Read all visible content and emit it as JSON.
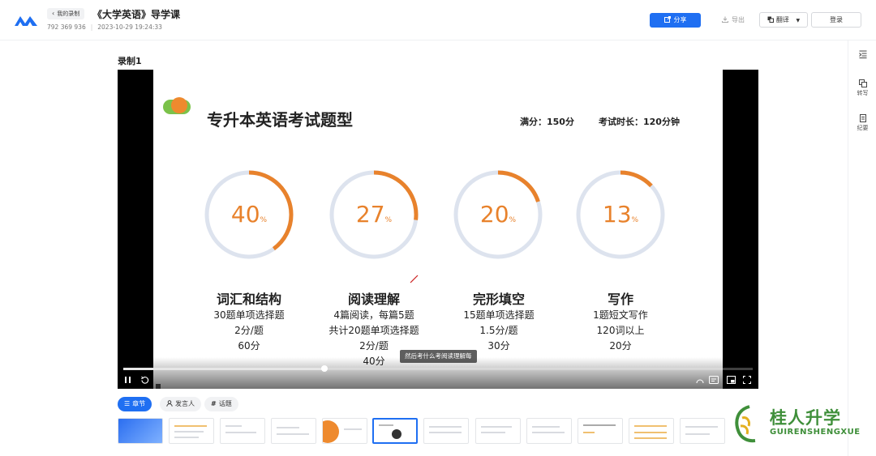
{
  "header": {
    "back_label": "我的录制",
    "title": "《大学英语》导学课",
    "meeting_id": "792 369 936",
    "datetime": "2023-10-29 19:24:33",
    "share_label": "分享",
    "export_label": "导出",
    "translate_label": "翻译",
    "login_label": "登录"
  },
  "right_rail": {
    "items": [
      {
        "label": ""
      },
      {
        "label": "转写"
      },
      {
        "label": "纪要"
      }
    ]
  },
  "section_title": "录制1",
  "slide": {
    "title": "专升本英语考试题型",
    "score": "满分：150分",
    "duration": "考试时长：120分钟",
    "items": [
      {
        "percent": "40",
        "unit": "%",
        "fraction": 0.4,
        "name": "词汇和结构",
        "lines": [
          "30题单项选择题",
          "2分/题",
          "60分"
        ]
      },
      {
        "percent": "27",
        "unit": "%",
        "fraction": 0.27,
        "name": "阅读理解",
        "lines": [
          "4篇阅读，每篇5题",
          "共计20题单项选择题",
          "2分/题",
          "40分"
        ]
      },
      {
        "percent": "20",
        "unit": "%",
        "fraction": 0.2,
        "name": "完形填空",
        "lines": [
          "15题单项选择题",
          "1.5分/题",
          "30分"
        ]
      },
      {
        "percent": "13",
        "unit": "%",
        "fraction": 0.13,
        "name": "写作",
        "lines": [
          "1题短文写作",
          "120词以上",
          "20分"
        ]
      }
    ]
  },
  "player": {
    "subtitle": "然后考什么考阅读理解每",
    "progress": 0.32
  },
  "tabs": [
    {
      "label": "章节"
    },
    {
      "label": "发言人"
    },
    {
      "label": "话题"
    }
  ],
  "watermark": {
    "title": "桂人升学",
    "subtitle": "GUIRENSHENGXUE"
  },
  "colors": {
    "accent": "#1f6ff2",
    "ring": "#e8822c",
    "ring_track": "#dde3ee",
    "brand_green": "#3f8f3a"
  }
}
